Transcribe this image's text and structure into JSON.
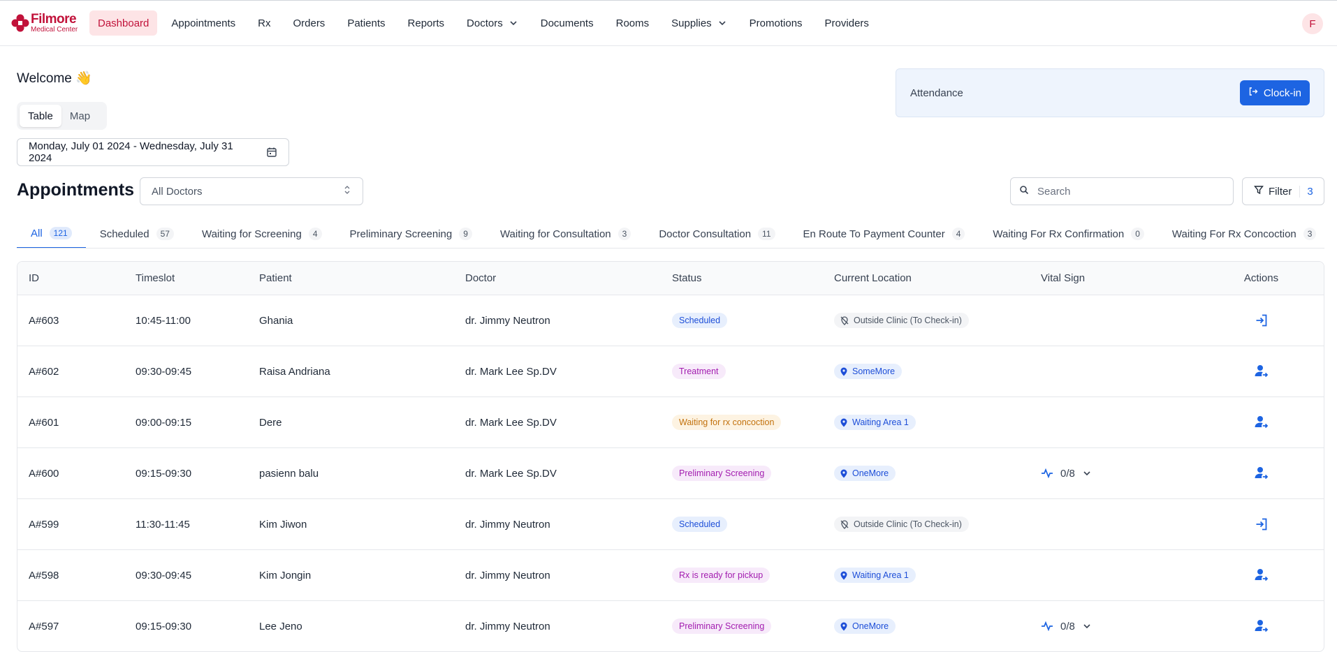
{
  "brand": {
    "name": "Filmore",
    "subtitle": "Medical Center",
    "color": "#c1123a"
  },
  "nav": {
    "items": [
      {
        "label": "Dashboard",
        "active": true
      },
      {
        "label": "Appointments"
      },
      {
        "label": "Rx"
      },
      {
        "label": "Orders"
      },
      {
        "label": "Patients"
      },
      {
        "label": "Reports"
      },
      {
        "label": "Doctors",
        "dropdown": true
      },
      {
        "label": "Documents"
      },
      {
        "label": "Rooms"
      },
      {
        "label": "Supplies",
        "dropdown": true
      },
      {
        "label": "Promotions"
      },
      {
        "label": "Providers"
      }
    ],
    "avatar_initial": "F"
  },
  "welcome": "Welcome 👋",
  "view_toggle": {
    "options": [
      "Table",
      "Map"
    ],
    "selected": "Table"
  },
  "date_range": "Monday, July 01 2024 - Wednesday, July 31 2024",
  "attendance": {
    "label": "Attendance",
    "button": "Clock-in"
  },
  "appointments": {
    "title": "Appointments",
    "doctor_select": "All Doctors",
    "search_placeholder": "Search",
    "filter_label": "Filter",
    "filter_count": "3"
  },
  "tabs": [
    {
      "label": "All",
      "count": "121",
      "active": true
    },
    {
      "label": "Scheduled",
      "count": "57"
    },
    {
      "label": "Waiting for Screening",
      "count": "4"
    },
    {
      "label": "Preliminary Screening",
      "count": "9"
    },
    {
      "label": "Waiting for Consultation",
      "count": "3"
    },
    {
      "label": "Doctor Consultation",
      "count": "11"
    },
    {
      "label": "En Route To Payment Counter",
      "count": "4"
    },
    {
      "label": "Waiting For Rx Confirmation",
      "count": "0"
    },
    {
      "label": "Waiting For Rx Concoction",
      "count": "3"
    }
  ],
  "table": {
    "headers": [
      "ID",
      "Timeslot",
      "Patient",
      "Doctor",
      "Status",
      "Current Location",
      "Vital Sign",
      "Actions"
    ],
    "rows": [
      {
        "id": "A#603",
        "timeslot": "10:45-11:00",
        "patient": "Ghania",
        "doctor": "dr. Jimmy Neutron",
        "status": "Scheduled",
        "status_color": "blue",
        "location": "Outside Clinic (To Check-in)",
        "location_type": "outside",
        "vital": "",
        "action": "check-in-icon"
      },
      {
        "id": "A#602",
        "timeslot": "09:30-09:45",
        "patient": "Raisa Andriana",
        "doctor": "dr. Mark Lee Sp.DV",
        "status": "Treatment",
        "status_color": "purple",
        "location": "SomeMore",
        "location_type": "inside",
        "vital": "",
        "action": "move-patient-icon"
      },
      {
        "id": "A#601",
        "timeslot": "09:00-09:15",
        "patient": "Dere",
        "doctor": "dr. Mark Lee Sp.DV",
        "status": "Waiting for rx concoction",
        "status_color": "orange",
        "location": "Waiting Area 1",
        "location_type": "inside",
        "vital": "",
        "action": "move-patient-icon"
      },
      {
        "id": "A#600",
        "timeslot": "09:15-09:30",
        "patient": "pasienn balu",
        "doctor": "dr. Mark Lee Sp.DV",
        "status": "Preliminary Screening",
        "status_color": "purple",
        "location": "OneMore",
        "location_type": "inside",
        "vital": "0/8",
        "action": "move-patient-icon"
      },
      {
        "id": "A#599",
        "timeslot": "11:30-11:45",
        "patient": "Kim Jiwon",
        "doctor": "dr. Jimmy Neutron",
        "status": "Scheduled",
        "status_color": "blue",
        "location": "Outside Clinic (To Check-in)",
        "location_type": "outside",
        "vital": "",
        "action": "check-in-icon"
      },
      {
        "id": "A#598",
        "timeslot": "09:30-09:45",
        "patient": "Kim Jongin",
        "doctor": "dr. Jimmy Neutron",
        "status": "Rx is ready for pickup",
        "status_color": "purple",
        "location": "Waiting Area 1",
        "location_type": "inside",
        "vital": "",
        "action": "move-patient-icon"
      },
      {
        "id": "A#597",
        "timeslot": "09:15-09:30",
        "patient": "Lee Jeno",
        "doctor": "dr. Jimmy Neutron",
        "status": "Preliminary Screening",
        "status_color": "purple",
        "location": "OneMore",
        "location_type": "inside",
        "vital": "0/8",
        "action": "move-patient-icon"
      }
    ]
  },
  "colors": {
    "primary": "#1d64e2",
    "brand": "#c1123a"
  }
}
